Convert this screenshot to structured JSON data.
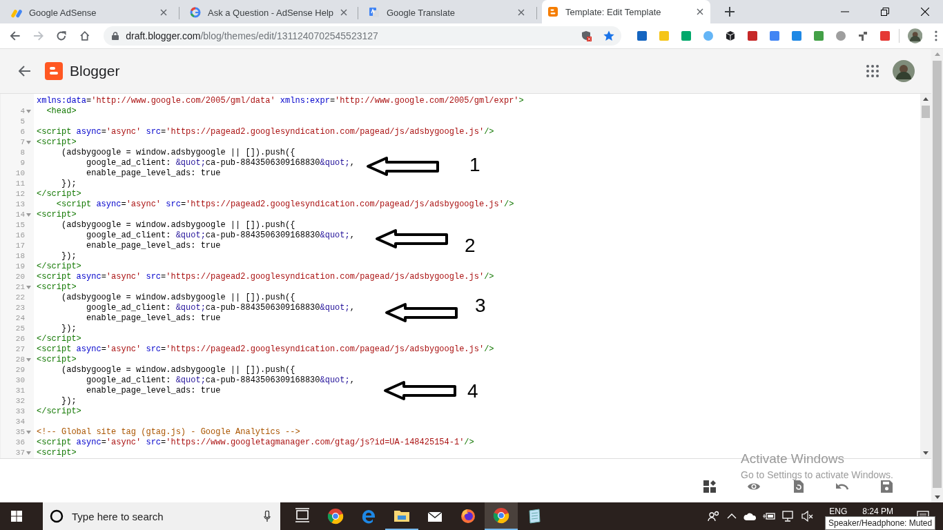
{
  "browser": {
    "tabs": [
      {
        "title": "Google AdSense",
        "selected": false,
        "kind": "adsense"
      },
      {
        "title": "Ask a Question - AdSense Help",
        "selected": false,
        "kind": "google"
      },
      {
        "title": "Google Translate",
        "selected": false,
        "kind": "translate"
      },
      {
        "title": "Template: Edit Template",
        "selected": true,
        "kind": "blogger"
      }
    ],
    "address": {
      "host": "draft.blogger.com",
      "path": "/blog/themes/edit/1311240702545523127"
    }
  },
  "app": {
    "title": "Blogger"
  },
  "editor": {
    "lines": [
      {
        "rows": [
          [
            {
              "kind": "attr",
              "text": "xmlns:data"
            },
            {
              "kind": "plain",
              "text": "="
            },
            {
              "kind": "str",
              "text": "'http://www.google.com/2005/gml/data'"
            },
            {
              "kind": "attr",
              "text": " xmlns:expr"
            },
            {
              "kind": "plain",
              "text": "="
            },
            {
              "kind": "str",
              "text": "'http://www.google.com/2005/gml/expr'"
            },
            {
              "kind": "tag",
              "text": ">"
            }
          ]
        ]
      },
      {
        "number": "4",
        "foldable": true,
        "rows": [
          [
            {
              "kind": "tag",
              "text": "  <head>"
            }
          ]
        ]
      },
      {
        "number": "5",
        "foldable": false
      },
      {
        "number": "6",
        "foldable": false,
        "rows": [
          [
            {
              "kind": "tag",
              "text": "<script"
            },
            {
              "kind": "attr",
              "text": " async"
            },
            {
              "kind": "plain",
              "text": "="
            },
            {
              "kind": "str",
              "text": "'async'"
            },
            {
              "kind": "attr",
              "text": " src"
            },
            {
              "kind": "plain",
              "text": "="
            },
            {
              "kind": "str",
              "text": "'https://pagead2.googlesyndication.com/pagead/js/adsbygoogle.js'"
            },
            {
              "kind": "tag",
              "text": "/>"
            }
          ]
        ]
      },
      {
        "number": "7",
        "foldable": true,
        "rows": [
          [
            {
              "kind": "tag",
              "text": "<script>"
            }
          ]
        ]
      },
      {
        "number": "8",
        "foldable": false,
        "rows": [
          [
            {
              "kind": "plain",
              "text": "     (adsbygoogle = window.adsbygoogle || []).push({"
            }
          ]
        ]
      },
      {
        "number": "9",
        "foldable": false,
        "rows": [
          [
            {
              "kind": "plain",
              "text": "          google_ad_client: "
            },
            {
              "kind": "ent",
              "text": "&quot;"
            },
            {
              "kind": "plain",
              "text": "ca-pub-8843506309168830"
            },
            {
              "kind": "ent",
              "text": "&quot;"
            },
            {
              "kind": "plain",
              "text": ","
            }
          ]
        ]
      },
      {
        "number": "10",
        "foldable": false,
        "rows": [
          [
            {
              "kind": "plain",
              "text": "          enable_page_level_ads: true"
            }
          ]
        ]
      },
      {
        "number": "11",
        "foldable": false,
        "rows": [
          [
            {
              "kind": "plain",
              "text": "     });"
            }
          ]
        ]
      },
      {
        "number": "12",
        "foldable": false,
        "rows": [
          [
            {
              "kind": "tag",
              "text": "</script>"
            }
          ]
        ]
      },
      {
        "number": "13",
        "foldable": false,
        "rows": [
          [
            {
              "kind": "tag",
              "text": "    <script"
            },
            {
              "kind": "attr",
              "text": " async"
            },
            {
              "kind": "plain",
              "text": "="
            },
            {
              "kind": "str",
              "text": "'async'"
            },
            {
              "kind": "attr",
              "text": " src"
            },
            {
              "kind": "plain",
              "text": "="
            },
            {
              "kind": "str",
              "text": "'https://pagead2.googlesyndication.com/pagead/js/adsbygoogle.js'"
            },
            {
              "kind": "tag",
              "text": "/>"
            }
          ]
        ]
      },
      {
        "number": "14",
        "foldable": true,
        "rows": [
          [
            {
              "kind": "tag",
              "text": "<script>"
            }
          ]
        ]
      },
      {
        "number": "15",
        "foldable": false,
        "rows": [
          [
            {
              "kind": "plain",
              "text": "     (adsbygoogle = window.adsbygoogle || []).push({"
            }
          ]
        ]
      },
      {
        "number": "16",
        "foldable": false,
        "rows": [
          [
            {
              "kind": "plain",
              "text": "          google_ad_client: "
            },
            {
              "kind": "ent",
              "text": "&quot;"
            },
            {
              "kind": "plain",
              "text": "ca-pub-8843506309168830"
            },
            {
              "kind": "ent",
              "text": "&quot;"
            },
            {
              "kind": "plain",
              "text": ","
            }
          ]
        ]
      },
      {
        "number": "17",
        "foldable": false,
        "rows": [
          [
            {
              "kind": "plain",
              "text": "          enable_page_level_ads: true"
            }
          ]
        ]
      },
      {
        "number": "18",
        "foldable": false,
        "rows": [
          [
            {
              "kind": "plain",
              "text": "     });"
            }
          ]
        ]
      },
      {
        "number": "19",
        "foldable": false,
        "rows": [
          [
            {
              "kind": "tag",
              "text": "</script>"
            }
          ]
        ]
      },
      {
        "number": "20",
        "foldable": false,
        "rows": [
          [
            {
              "kind": "tag",
              "text": "<script"
            },
            {
              "kind": "attr",
              "text": " async"
            },
            {
              "kind": "plain",
              "text": "="
            },
            {
              "kind": "str",
              "text": "'async'"
            },
            {
              "kind": "attr",
              "text": " src"
            },
            {
              "kind": "plain",
              "text": "="
            },
            {
              "kind": "str",
              "text": "'https://pagead2.googlesyndication.com/pagead/js/adsbygoogle.js'"
            },
            {
              "kind": "tag",
              "text": "/>"
            }
          ]
        ]
      },
      {
        "number": "21",
        "foldable": true,
        "rows": [
          [
            {
              "kind": "tag",
              "text": "<script>"
            }
          ]
        ]
      },
      {
        "number": "22",
        "foldable": false,
        "rows": [
          [
            {
              "kind": "plain",
              "text": "     (adsbygoogle = window.adsbygoogle || []).push({"
            }
          ]
        ]
      },
      {
        "number": "23",
        "foldable": false,
        "rows": [
          [
            {
              "kind": "plain",
              "text": "          google_ad_client: "
            },
            {
              "kind": "ent",
              "text": "&quot;"
            },
            {
              "kind": "plain",
              "text": "ca-pub-8843506309168830"
            },
            {
              "kind": "ent",
              "text": "&quot;"
            },
            {
              "kind": "plain",
              "text": ","
            }
          ]
        ]
      },
      {
        "number": "24",
        "foldable": false,
        "rows": [
          [
            {
              "kind": "plain",
              "text": "          enable_page_level_ads: true"
            }
          ]
        ]
      },
      {
        "number": "25",
        "foldable": false,
        "rows": [
          [
            {
              "kind": "plain",
              "text": "     });"
            }
          ]
        ]
      },
      {
        "number": "26",
        "foldable": false,
        "rows": [
          [
            {
              "kind": "tag",
              "text": "</script>"
            }
          ]
        ]
      },
      {
        "number": "27",
        "foldable": false,
        "rows": [
          [
            {
              "kind": "tag",
              "text": "<script"
            },
            {
              "kind": "attr",
              "text": " async"
            },
            {
              "kind": "plain",
              "text": "="
            },
            {
              "kind": "str",
              "text": "'async'"
            },
            {
              "kind": "attr",
              "text": " src"
            },
            {
              "kind": "plain",
              "text": "="
            },
            {
              "kind": "str",
              "text": "'https://pagead2.googlesyndication.com/pagead/js/adsbygoogle.js'"
            },
            {
              "kind": "tag",
              "text": "/>"
            }
          ]
        ]
      },
      {
        "number": "28",
        "foldable": true,
        "rows": [
          [
            {
              "kind": "tag",
              "text": "<script>"
            }
          ]
        ]
      },
      {
        "number": "29",
        "foldable": false,
        "rows": [
          [
            {
              "kind": "plain",
              "text": "     (adsbygoogle = window.adsbygoogle || []).push({"
            }
          ]
        ]
      },
      {
        "number": "30",
        "foldable": false,
        "rows": [
          [
            {
              "kind": "plain",
              "text": "          google_ad_client: "
            },
            {
              "kind": "ent",
              "text": "&quot;"
            },
            {
              "kind": "plain",
              "text": "ca-pub-8843506309168830"
            },
            {
              "kind": "ent",
              "text": "&quot;"
            },
            {
              "kind": "plain",
              "text": ","
            }
          ]
        ]
      },
      {
        "number": "31",
        "foldable": false,
        "rows": [
          [
            {
              "kind": "plain",
              "text": "          enable_page_level_ads: true"
            }
          ]
        ]
      },
      {
        "number": "32",
        "foldable": false,
        "rows": [
          [
            {
              "kind": "plain",
              "text": "     });"
            }
          ]
        ]
      },
      {
        "number": "33",
        "foldable": false,
        "rows": [
          [
            {
              "kind": "tag",
              "text": "</script>"
            }
          ]
        ]
      },
      {
        "number": "34",
        "foldable": false
      },
      {
        "number": "35",
        "foldable": true,
        "rows": [
          [
            {
              "kind": "cmt",
              "text": "<!-- Global site tag (gtag.js) - Google Analytics -->"
            }
          ]
        ]
      },
      {
        "number": "36",
        "foldable": false,
        "rows": [
          [
            {
              "kind": "tag",
              "text": "<script"
            },
            {
              "kind": "attr",
              "text": " async"
            },
            {
              "kind": "plain",
              "text": "="
            },
            {
              "kind": "str",
              "text": "'async'"
            },
            {
              "kind": "attr",
              "text": " src"
            },
            {
              "kind": "plain",
              "text": "="
            },
            {
              "kind": "str",
              "text": "'https://www.googletagmanager.com/gtag/js?id=UA-148425154-1'"
            },
            {
              "kind": "tag",
              "text": "/>"
            }
          ]
        ]
      },
      {
        "number": "37",
        "foldable": true,
        "rows": [
          [
            {
              "kind": "tag",
              "text": "<script>"
            }
          ]
        ]
      }
    ],
    "annotations": [
      {
        "label": "1"
      },
      {
        "label": "2"
      },
      {
        "label": "3"
      },
      {
        "label": "4"
      }
    ]
  },
  "activation_notice": {
    "title": "Activate Windows",
    "subtitle": "Go to Settings to activate Windows."
  },
  "taskbar": {
    "search": {
      "placeholder": "Type here to search"
    },
    "apps": [
      {
        "kind": "taskview",
        "running": false,
        "selected": false
      },
      {
        "kind": "chrome",
        "running": false,
        "selected": false
      },
      {
        "kind": "edge",
        "running": false,
        "selected": false
      },
      {
        "kind": "files",
        "running": true,
        "selected": false
      },
      {
        "kind": "mail",
        "running": false,
        "selected": false
      },
      {
        "kind": "firefox",
        "running": false,
        "selected": false
      },
      {
        "kind": "chrome",
        "running": true,
        "selected": true
      },
      {
        "kind": "notepad",
        "running": false,
        "selected": false
      }
    ],
    "language": "ENG",
    "time": "8:24 PM",
    "tooltip": "Speaker/Headphone: Muted"
  }
}
